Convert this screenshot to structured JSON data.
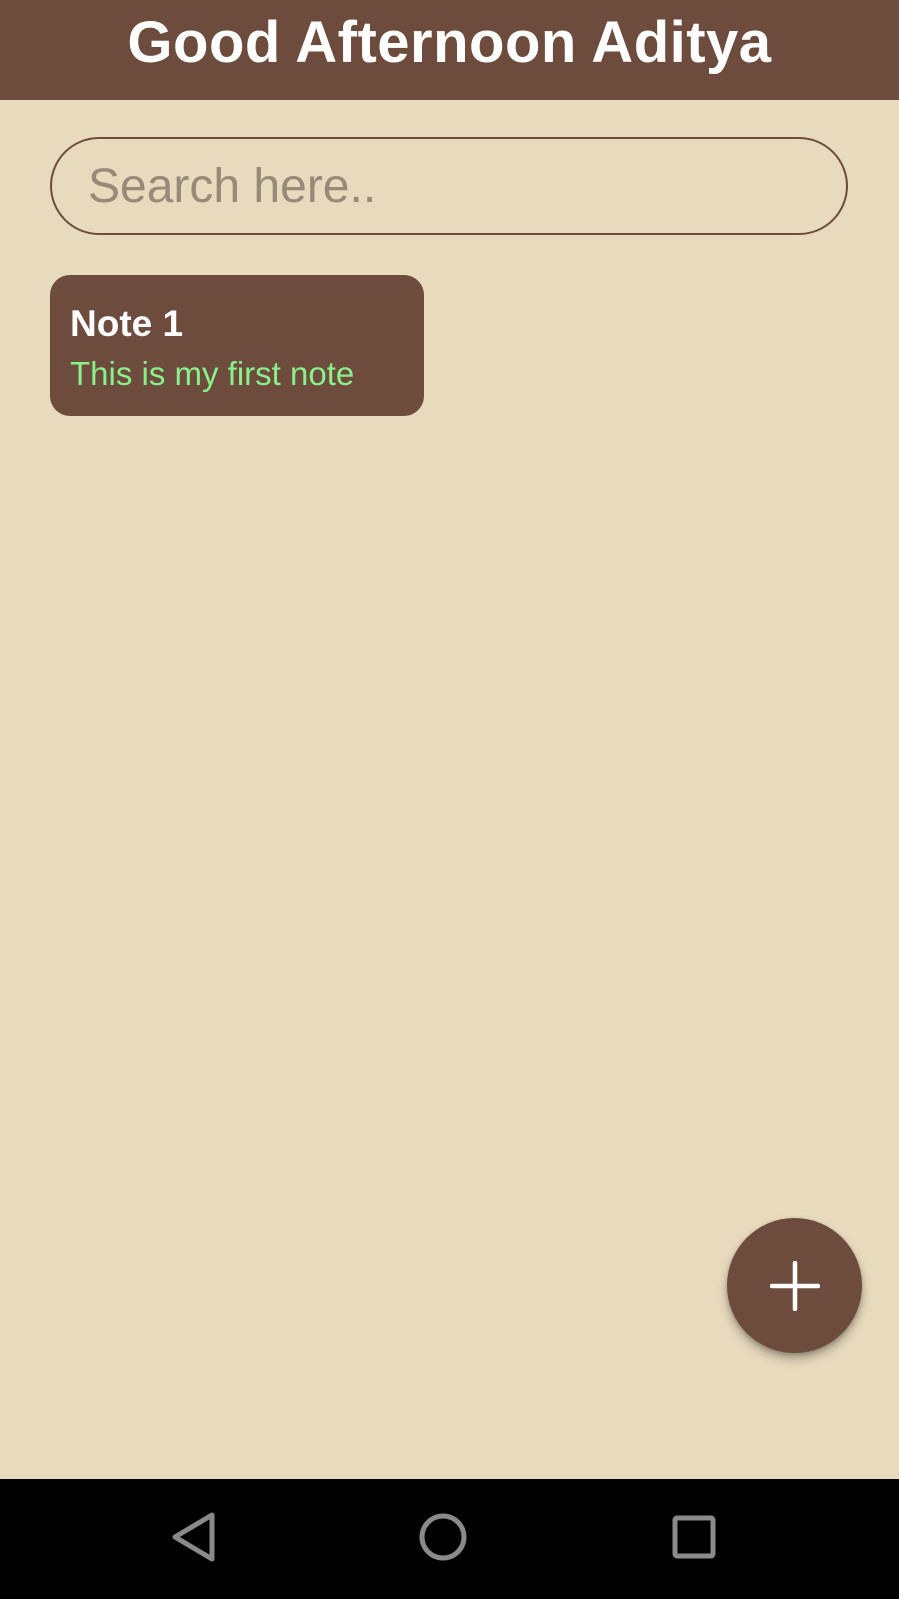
{
  "header": {
    "title": "Good Afternoon Aditya"
  },
  "search": {
    "placeholder": "Search here..",
    "value": ""
  },
  "notes": [
    {
      "title": "Note 1",
      "body": "This is my first note"
    }
  ],
  "fab": {
    "icon": "plus-icon"
  },
  "nav_bar": {
    "buttons": [
      "back-icon",
      "home-icon",
      "recents-icon"
    ]
  },
  "colors": {
    "background": "#e8dabd",
    "primary": "#6d4c3d",
    "note_body_text": "#8af08a",
    "header_text": "#ffffff",
    "nav_bar": "#000000"
  }
}
